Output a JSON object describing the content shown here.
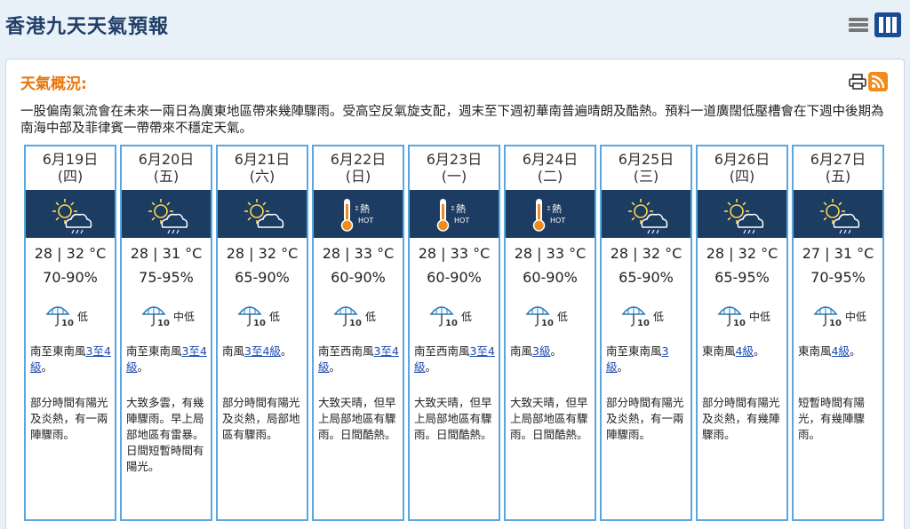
{
  "header": {
    "title": "香港九天天氣預報"
  },
  "section": {
    "title": "天氣概況:"
  },
  "summary": "一股偏南氣流會在未來一兩日為廣東地區帶來幾陣驟雨。受高空反氣旋支配，週末至下週初華南普遍晴朗及酷熱。預料一道廣闊低壓槽會在下週中後期為南海中部及菲律賓一帶帶來不穩定天氣。",
  "icons": {
    "print": "print-icon",
    "rss": "rss-icon",
    "list_view": "list-view-icon",
    "grid_view": "grid-view-icon"
  },
  "colors": {
    "accent": "#e8760a",
    "title": "#1f3e68",
    "band": "#1c3c62",
    "border": "#5aa6df",
    "link": "#1a4bb0"
  },
  "psr_value": "10",
  "days": [
    {
      "date": "6月19日",
      "weekday": "(四)",
      "icon": "sunny-periods-showers",
      "temp": "28 | 32 °C",
      "rh": "70-90%",
      "psr": "低",
      "wind_pre": "南至東南風",
      "wind_link": "3至4級",
      "wind_post": "。",
      "desc": "部分時間有陽光及炎熱，有一兩陣驟雨。"
    },
    {
      "date": "6月20日",
      "weekday": "(五)",
      "icon": "sunny-periods-showers",
      "temp": "28 | 31 °C",
      "rh": "75-95%",
      "psr": "中低",
      "wind_pre": "南至東南風",
      "wind_link": "3至4級",
      "wind_post": "。",
      "desc": "大致多雲，有幾陣驟雨。早上局部地區有雷暴。日間短暫時間有陽光。"
    },
    {
      "date": "6月21日",
      "weekday": "(六)",
      "icon": "sunny-periods",
      "temp": "28 | 32 °C",
      "rh": "65-90%",
      "psr": "低",
      "wind_pre": "南風",
      "wind_link": "3至4級",
      "wind_post": "。",
      "desc": "部分時間有陽光及炎熱，局部地區有驟雨。"
    },
    {
      "date": "6月22日",
      "weekday": "(日)",
      "icon": "hot",
      "temp": "28 | 33 °C",
      "rh": "60-90%",
      "psr": "低",
      "wind_pre": "南至西南風",
      "wind_link": "3至4級",
      "wind_post": "。",
      "desc": "大致天晴，但早上局部地區有驟雨。日間酷熱。"
    },
    {
      "date": "6月23日",
      "weekday": "(一)",
      "icon": "hot",
      "temp": "28 | 33 °C",
      "rh": "60-90%",
      "psr": "低",
      "wind_pre": "南至西南風",
      "wind_link": "3至4級",
      "wind_post": "。",
      "desc": "大致天晴，但早上局部地區有驟雨。日間酷熱。"
    },
    {
      "date": "6月24日",
      "weekday": "(二)",
      "icon": "hot",
      "temp": "28 | 33 °C",
      "rh": "60-90%",
      "psr": "低",
      "wind_pre": "南風",
      "wind_link": "3級",
      "wind_post": "。",
      "desc": "大致天晴，但早上局部地區有驟雨。日間酷熱。"
    },
    {
      "date": "6月25日",
      "weekday": "(三)",
      "icon": "sunny-periods-showers",
      "temp": "28 | 32 °C",
      "rh": "65-90%",
      "psr": "低",
      "wind_pre": "南至東南風",
      "wind_link": "3級",
      "wind_post": "。",
      "desc": "部分時間有陽光及炎熱，有一兩陣驟雨。"
    },
    {
      "date": "6月26日",
      "weekday": "(四)",
      "icon": "sunny-periods-showers",
      "temp": "28 | 32 °C",
      "rh": "65-95%",
      "psr": "中低",
      "wind_pre": "東南風",
      "wind_link": "4級",
      "wind_post": "。",
      "desc": "部分時間有陽光及炎熱，有幾陣驟雨。"
    },
    {
      "date": "6月27日",
      "weekday": "(五)",
      "icon": "sunny-periods-showers",
      "temp": "27 | 31 °C",
      "rh": "70-95%",
      "psr": "中低",
      "wind_pre": "東南風",
      "wind_link": "4級",
      "wind_post": "。",
      "desc": "短暫時間有陽光，有幾陣驟雨。"
    }
  ]
}
